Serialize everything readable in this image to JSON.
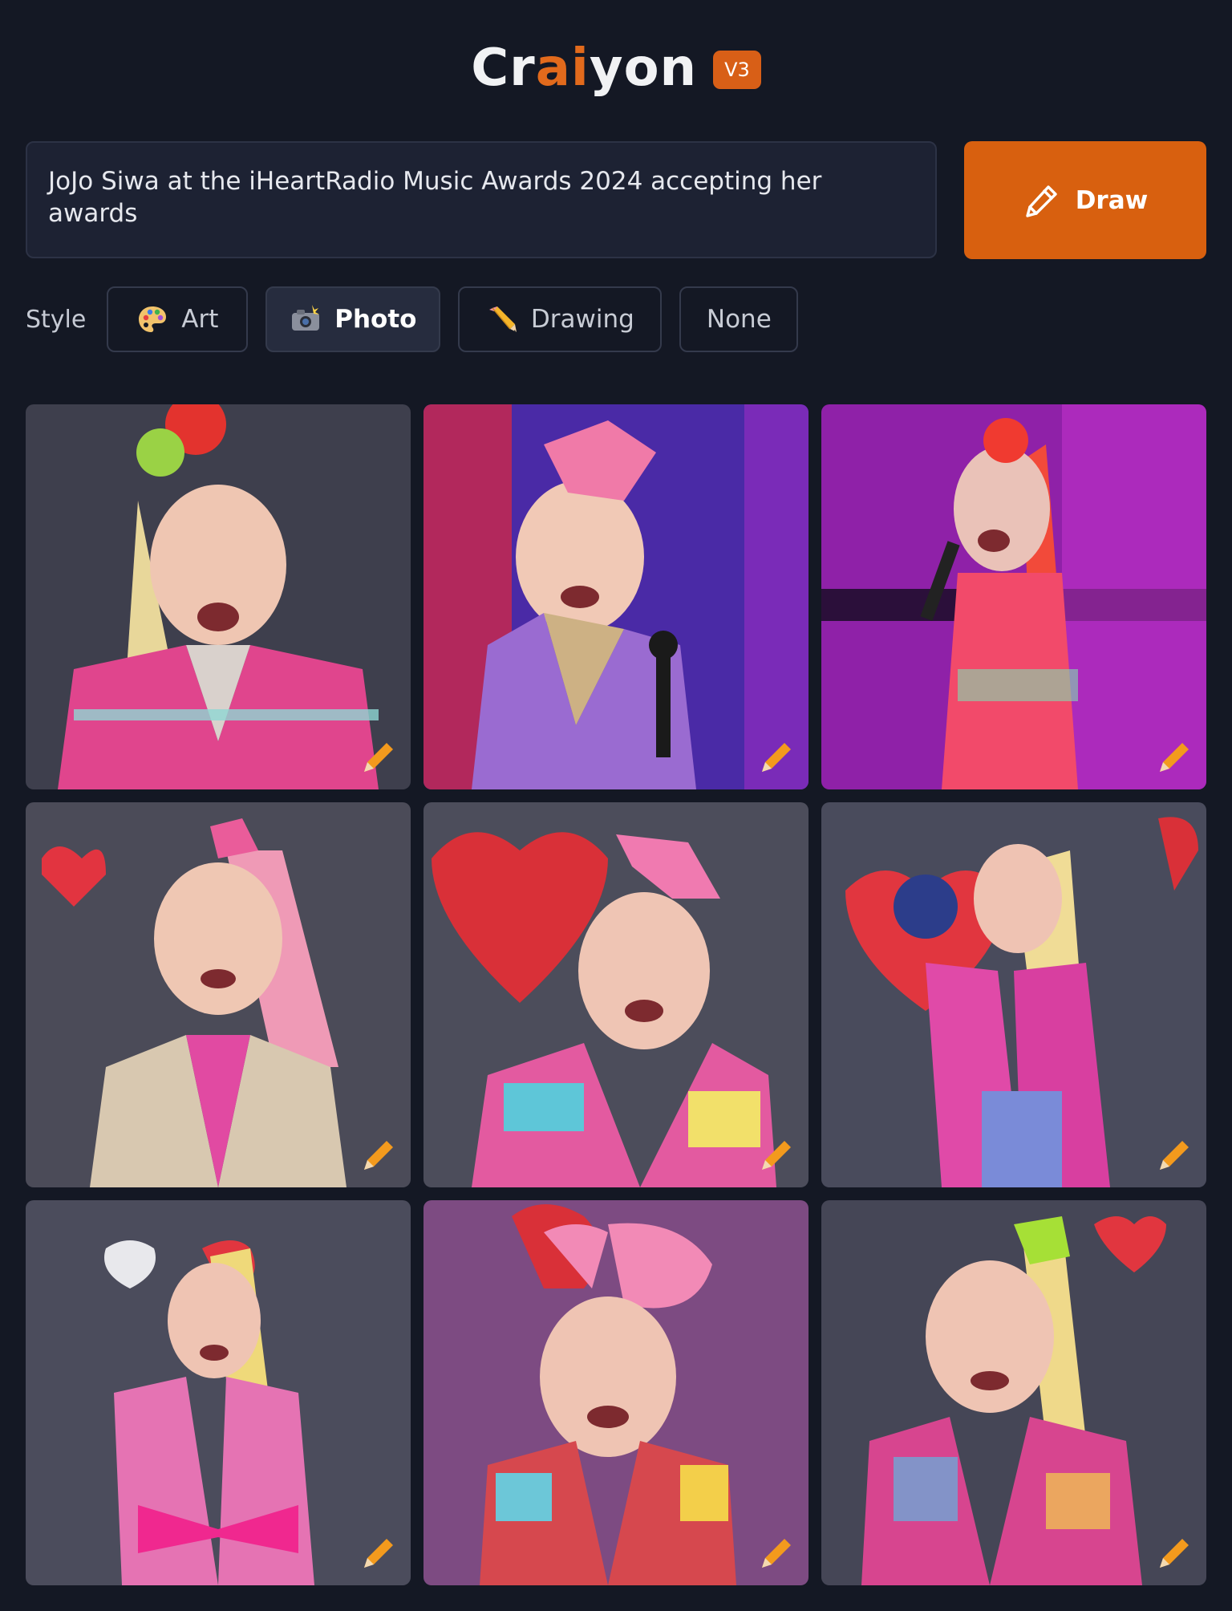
{
  "app": {
    "logo": {
      "prefix": "Cr",
      "accent1": "a",
      "middle": "i",
      "suffix": "yon"
    },
    "version_badge": "V3",
    "accent_color": "#d8600f"
  },
  "prompt": {
    "value": "JoJo Siwa at the iHeartRadio Music Awards 2024 accepting her awards"
  },
  "draw_button": {
    "label": "Draw",
    "icon": "pencil-icon"
  },
  "style": {
    "label": "Style",
    "options": [
      {
        "label": "Art",
        "icon": "palette-icon",
        "active": false
      },
      {
        "label": "Photo",
        "icon": "camera-flash-icon",
        "active": true
      },
      {
        "label": "Drawing",
        "icon": "pencil-emoji-icon",
        "active": false
      },
      {
        "label": "None",
        "icon": "",
        "active": false
      }
    ]
  },
  "results": {
    "count": 9,
    "items": [
      {
        "alt": "Generated image 1",
        "edit_icon": "edit-pencil-icon"
      },
      {
        "alt": "Generated image 2",
        "edit_icon": "edit-pencil-icon"
      },
      {
        "alt": "Generated image 3",
        "edit_icon": "edit-pencil-icon"
      },
      {
        "alt": "Generated image 4",
        "edit_icon": "edit-pencil-icon"
      },
      {
        "alt": "Generated image 5",
        "edit_icon": "edit-pencil-icon"
      },
      {
        "alt": "Generated image 6",
        "edit_icon": "edit-pencil-icon"
      },
      {
        "alt": "Generated image 7",
        "edit_icon": "edit-pencil-icon"
      },
      {
        "alt": "Generated image 8",
        "edit_icon": "edit-pencil-icon"
      },
      {
        "alt": "Generated image 9",
        "edit_icon": "edit-pencil-icon"
      }
    ]
  }
}
